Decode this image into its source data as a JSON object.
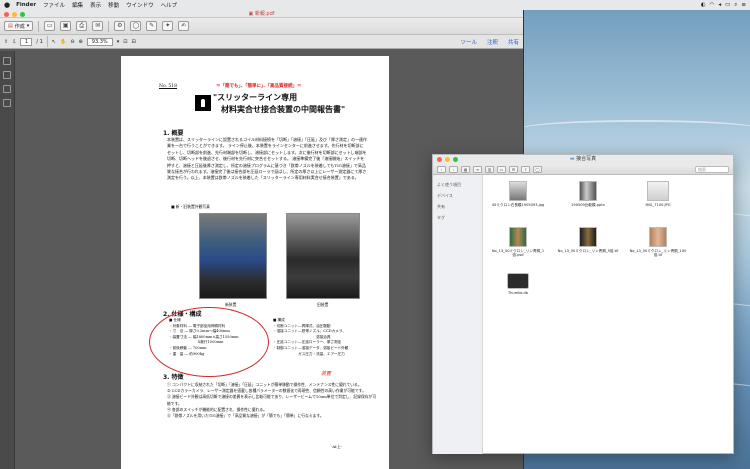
{
  "menubar": {
    "apple": "",
    "items": [
      "Finder",
      "ファイル",
      "編集",
      "表示",
      "移動",
      "ウインドウ",
      "ヘルプ"
    ]
  },
  "pdf": {
    "window_title": "新報.pdf",
    "create_label": "作成",
    "page_current": "1",
    "page_total": "/ 1",
    "zoom": "93.3%",
    "tools_label": "ツール",
    "comment_label": "注釈",
    "share_label": "共有"
  },
  "doc": {
    "number": "No. 518",
    "slogan": "＝「簡でも」、「簡単に」、「高品質接続」＝",
    "title_line1": "\"スリッターライン専用",
    "title_line2": "材料実合せ接合装置の中間報告書\"",
    "section1": "1. 概要",
    "section1_body": "本装置は、スリッターラインに設置されるコイル材料接続を「切断」「溶接」「圧延」及び「厚さ測定」の一連作業を一台で行うことができます。 ライン停止後、本装置をラインセンターに前進させます。先行材を切断部にセットし、切断部を前進、先行材端部を切断し、溶接部にセットします。次に後行材を切断部にセットし端部を切断、切断ヘッドを後退させ、後行材を先行材に突合せセットする。 溶接準備完了後「溶接開始」スイッチを押すと、溶接と圧延後厚さ測定し、所定の溶接プログラムに基づき「鉄帯ノズルを装着してもTIG溶接」で高品質な接合が行われます。溶接完了後は接合部を圧延ローラで延ばし、所定の厚さ以上にレーザー測定器にて厚さ測定を行う。以上、本装置は鉄帯ノズルを装着した「スリッターライン専用材料実合せ接合装置」である。",
    "photo_caption_header": "■ 新・旧装置外観写真",
    "caption_new": "新装置",
    "caption_old": "旧装置",
    "section2": "2. 仕様・構成",
    "spec_header": "■ 仕様",
    "spec_lines": [
      "・対象材料 ― 電子部品用伸銅材料",
      "・寸　法 ― 厚さ0.2mm〜幅400mm",
      "・装置寸法 ― 幅1800mm×高さ1550mm",
      "　　　　　　　　X奥行1500mm",
      "・前後移動 ― 700mm",
      "・重　量 ― 約900kg"
    ],
    "config_header": "■ 構成",
    "config_lines": [
      "・切断ユニット―昇降式、油圧駆動",
      "・溶接ユニット―鉄帯ノズル、CCDカメラ、",
      "　　　　　　　　　　　　溶接治具",
      "・圧延ユニット―圧延ローラー、厚さ測定",
      "・制御ユニット―溶接データ、溶接ビード外観",
      "　　　　　　　ガス圧力・流量、エアー圧力"
    ],
    "section3": "3. 特徴",
    "feature_lines": [
      "① コンパクトに収納された「切断」「溶接」「圧延」ユニットが簡単移動で操作性、メンテナンス性に優れている。",
      "② CCDカラーカメラ、レーザー測定器を搭載し各種パラメーターの数値化で再現性、信頼性の高い作業が可能です。",
      "③ 溶接ビード外観は高低切断で溶接の差異を表示し比較可能であり、レーザービームで10um単位で判定し、記録保存が可能です。",
      "④ 各部のスイッチが機能的に配置され、操作性に優れる。",
      "⑤「鉄帯ノズルを用いたTIG溶接」で「高品質な溶接」が「簡でも」「簡単」に行なえます。"
    ],
    "handwritten_note": "装置",
    "footer": "-At上-"
  },
  "finder": {
    "window_title": "接合写真",
    "search_placeholder": "検索",
    "sidebar": [
      "よく使う項目",
      "デバイス",
      "共有",
      "タグ"
    ],
    "files": [
      {
        "name": "45ミクロン右長模1905093.jpg",
        "thumb": "photo"
      },
      {
        "name": "190509比較模.pptx",
        "thumb": "pptx"
      },
      {
        "name": "IMG_7100.JPG",
        "thumb": "photo-light"
      },
      {
        "name": "No_13_50ミクロン_リン青銅_1倍.psd",
        "thumb": "strip"
      },
      {
        "name": "No_13_50ミクロン_リン青銅_5倍.tif",
        "thumb": "strip-dark"
      },
      {
        "name": "No_13_50ミクロン_リン青銅_100倍.tif",
        "thumb": "copper"
      },
      {
        "name": "Thumbs.db",
        "thumb": "db"
      }
    ]
  }
}
